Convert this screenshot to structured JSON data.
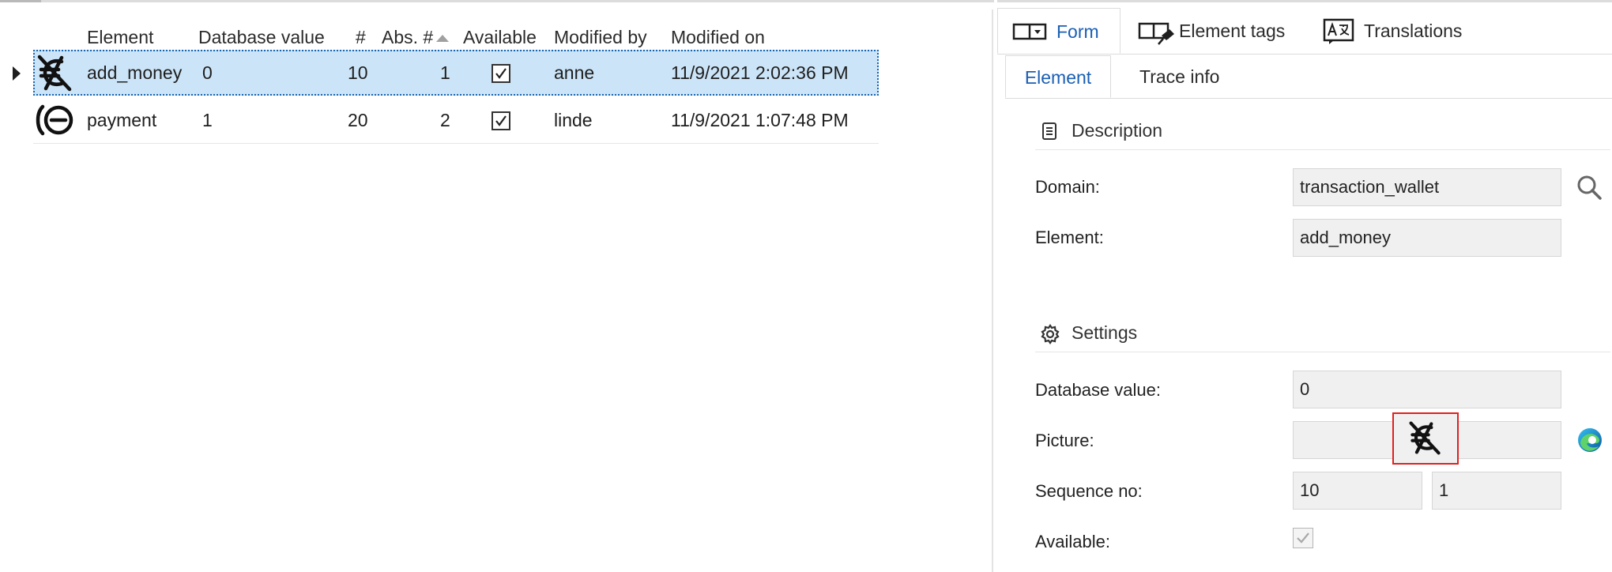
{
  "grid": {
    "columns": {
      "element": "Element",
      "database_value": "Database value",
      "number": "#",
      "abs_number": "Abs. #",
      "available": "Available",
      "modified_by": "Modified by",
      "modified_on": "Modified on"
    },
    "rows": [
      {
        "icon": "no-currency-icon",
        "element": "add_money",
        "database_value": "0",
        "number": "10",
        "abs_number": "1",
        "available": true,
        "modified_by": "anne",
        "modified_on": "11/9/2021 2:02:36 PM"
      },
      {
        "icon": "payment-minus-icon",
        "element": "payment",
        "database_value": "1",
        "number": "20",
        "abs_number": "2",
        "available": true,
        "modified_by": "linde",
        "modified_on": "11/9/2021 1:07:48 PM"
      }
    ]
  },
  "panel": {
    "tabs": [
      {
        "label": "Form",
        "icon": "form-icon",
        "active": true
      },
      {
        "label": "Element tags",
        "icon": "tag-pin-icon",
        "active": false
      },
      {
        "label": "Translations",
        "icon": "translate-icon",
        "active": false
      }
    ],
    "subtabs": [
      {
        "label": "Element",
        "active": true
      },
      {
        "label": "Trace info",
        "active": false
      }
    ],
    "description": {
      "title": "Description",
      "domain_label": "Domain:",
      "domain_value": "transaction_wallet",
      "element_label": "Element:",
      "element_value": "add_money"
    },
    "settings": {
      "title": "Settings",
      "database_value_label": "Database value:",
      "database_value": "0",
      "picture_label": "Picture:",
      "sequence_label": "Sequence no:",
      "sequence_value": "10",
      "sequence_abs_value": "1",
      "available_label": "Available:",
      "available_checked": true
    }
  },
  "colors": {
    "selection": "#cce4f7",
    "accent": "#1a5fb4",
    "highlight_border": "#e02020"
  }
}
